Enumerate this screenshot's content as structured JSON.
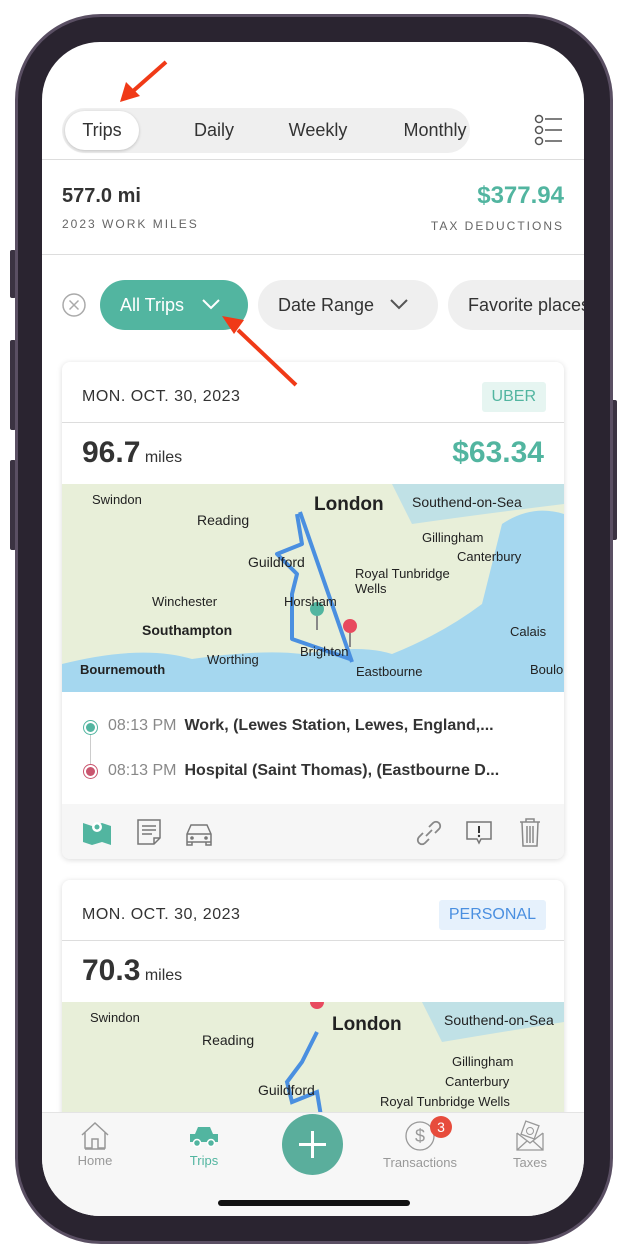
{
  "segments": [
    "Trips",
    "Daily",
    "Weekly",
    "Monthly"
  ],
  "summary": {
    "miles": "577.0 mi",
    "miles_label": "2023 WORK MILES",
    "deductions": "$377.94",
    "deductions_label": "TAX DEDUCTIONS"
  },
  "filters": [
    "All Trips",
    "Date Range",
    "Favorite places"
  ],
  "trips": [
    {
      "date": "MON. OCT. 30, 2023",
      "badge": "UBER",
      "miles": "96.7",
      "unit": "miles",
      "amount": "$63.34",
      "stops": [
        {
          "time": "08:13 PM",
          "place": "Work, (Lewes Station, Lewes, England,..."
        },
        {
          "time": "08:13 PM",
          "place": "Hospital (Saint Thomas), (Eastbourne D..."
        }
      ]
    },
    {
      "date": "MON. OCT. 30, 2023",
      "badge": "PERSONAL",
      "miles": "70.3",
      "unit": "miles"
    }
  ],
  "map1": [
    "Swindon",
    "London",
    "Southend-on-Sea",
    "Reading",
    "Gillingham",
    "Canterbury",
    "Guildford",
    "Royal Tunbridge Wells",
    "Winchester",
    "Horsham",
    "Southampton",
    "Calais",
    "Worthing",
    "Brighton",
    "Eastbourne",
    "Bournemouth",
    "Boulo"
  ],
  "map2": [
    "Swindon",
    "London",
    "Southend-on-Sea",
    "Reading",
    "Gillingham",
    "Canterbury",
    "Guildford",
    "Royal Tunbridge Wells"
  ],
  "tabs": [
    "Home",
    "Trips",
    "Transactions",
    "Taxes"
  ],
  "transactions_badge": "3",
  "colors": {
    "accent": "#52b5a0",
    "start": "#52b5a0",
    "end": "#c9566f",
    "route": "#4a8fe0",
    "annotation_arrow": "#f03a17"
  }
}
